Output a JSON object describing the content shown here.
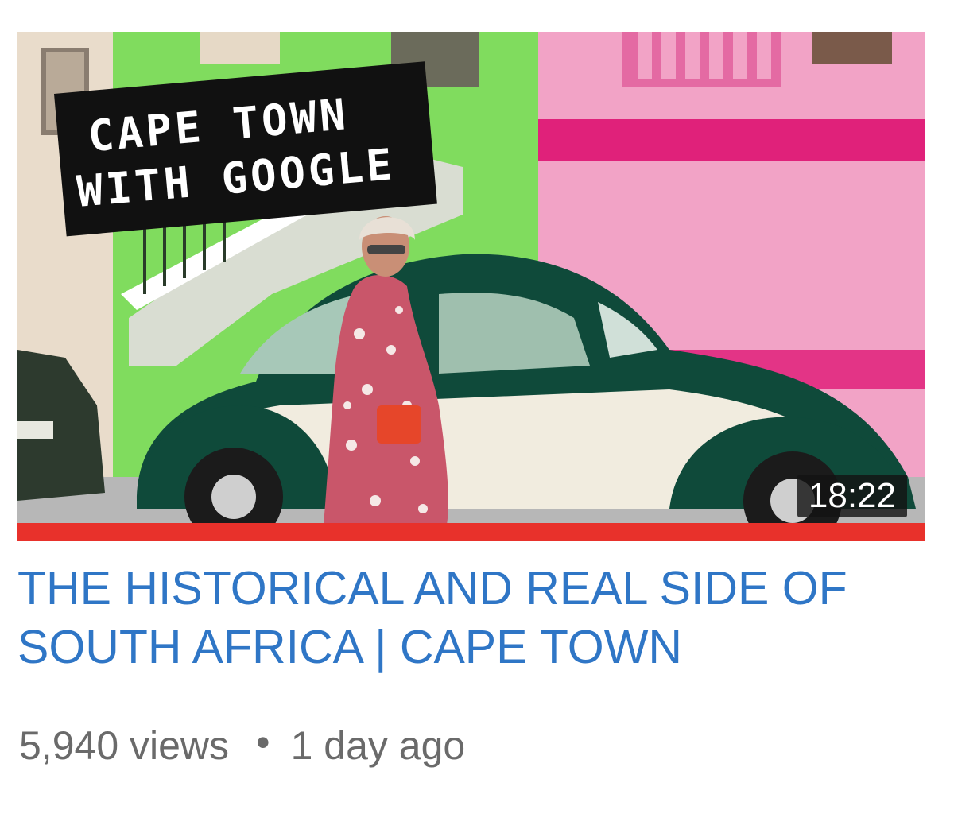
{
  "video": {
    "thumbnail": {
      "overlay_line_1": "CAPE TOWN",
      "overlay_line_2": "WITH GOOGLE",
      "duration": "18:22",
      "watched_fraction": 1.0
    },
    "title": "THE HISTORICAL AND REAL SIDE OF SOUTH AFRICA | CAPE TOWN",
    "views": "5,940 views",
    "separator": "•",
    "age": "1 day ago"
  },
  "colors": {
    "title": "#2f76c6",
    "meta": "#6a6a6a",
    "progress": "#e8312b",
    "wall_pink": "#f2a3c6",
    "wall_green": "#7fdc5f",
    "stripe_magenta": "#e0217a",
    "car_green": "#0f4a3a",
    "car_cream": "#f1ecdf"
  },
  "icons": {
    "thumbnail": "video-thumbnail-image"
  }
}
